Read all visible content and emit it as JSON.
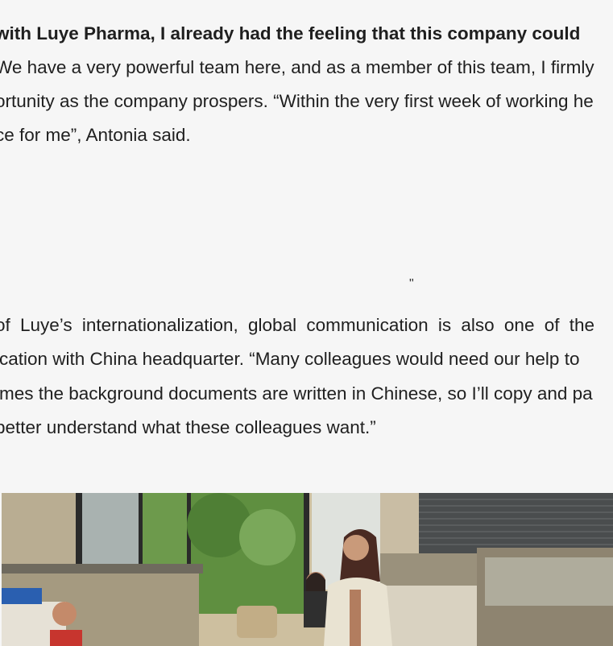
{
  "paragraph1": {
    "line1": "with Luye Pharma, I already had the feeling that this company  could",
    "line2": "We have a very powerful team here, and as a member of this team, I firmly",
    "line3": "ortunity as the company prospers. “Within the very first week of working he",
    "line4": "ce for me”, Antonia said."
  },
  "quote_mark": "\"",
  "paragraph2": {
    "line1": "of Luye’s internationalization, global communication is also one of the",
    "line2": "ication with China headquarter. “Many colleagues would need our help to",
    "line3": "imes the background documents are written in Chinese, so I’ll copy and pa",
    "line4": " better understand what these colleagues want.”"
  },
  "photo": {
    "subject": "office-photo",
    "colors": {
      "wall": "#cfc3a8",
      "window": "#7da35a",
      "partition": "#a89c84",
      "desk": "#e2dccd"
    }
  }
}
